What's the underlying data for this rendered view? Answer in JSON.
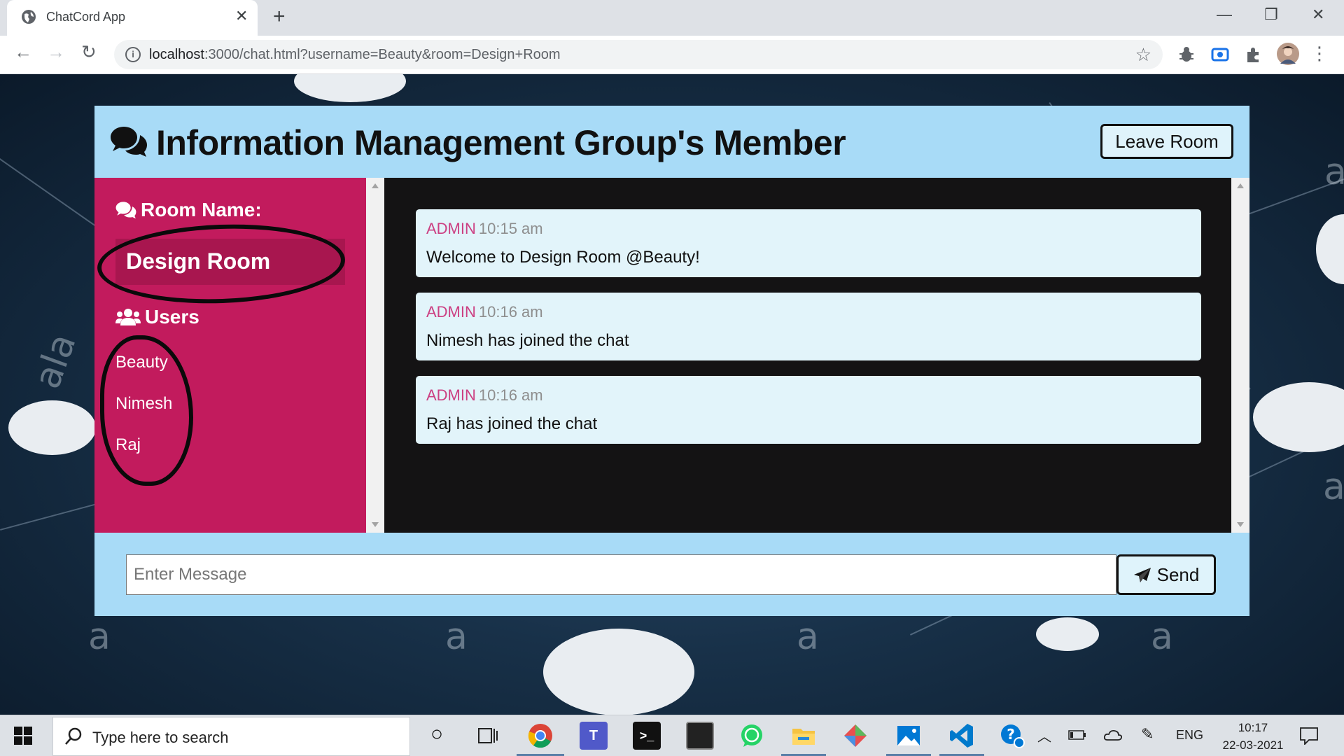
{
  "browser": {
    "tab_title": "ChatCord App",
    "tab_close": "✕",
    "new_tab": "+",
    "url_host": "localhost",
    "url_rest": ":3000/chat.html?username=Beauty&room=Design+Room",
    "window_controls": [
      "—",
      "❐",
      "✕"
    ]
  },
  "page_background": {
    "letters": [
      "a",
      "a",
      "a",
      "a",
      "a",
      "a",
      "ala"
    ]
  },
  "chat": {
    "title": "Information Management Group's Member",
    "leave_button": "Leave Room",
    "room_label": "Room Name:",
    "room_name": "Design Room",
    "users_label": "Users",
    "users": [
      "Beauty",
      "Nimesh",
      "Raj"
    ],
    "messages": [
      {
        "user": "ADMIN",
        "time": "10:15 am",
        "text": "Welcome to Design Room @Beauty!"
      },
      {
        "user": "ADMIN",
        "time": "10:16 am",
        "text": "Nimesh has joined the chat"
      },
      {
        "user": "ADMIN",
        "time": "10:16 am",
        "text": "Raj has joined the chat"
      }
    ],
    "input_placeholder": "Enter Message",
    "send_button": "Send",
    "colors": {
      "header": "#a8dbf7",
      "sidebar": "#c21b5d",
      "room_box": "#a8164f",
      "messages_bg": "#141314",
      "message_card": "#e2f4fa",
      "username": "#cc3f82"
    }
  },
  "taskbar": {
    "search_placeholder": "Type here to search",
    "language": "ENG",
    "time": "10:17",
    "date": "22-03-2021",
    "apps": [
      "cortana-icon",
      "task-view-icon",
      "chrome-icon",
      "teams-icon",
      "terminal-icon",
      "cmd-icon",
      "whatsapp-icon",
      "file-explorer-icon",
      "git-icon",
      "photos-icon",
      "vscode-icon",
      "help-icon"
    ]
  }
}
